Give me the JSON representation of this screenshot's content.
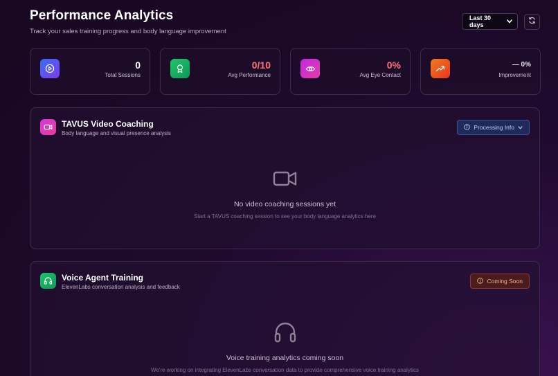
{
  "header": {
    "title": "Performance Analytics",
    "subtitle": "Track your sales training progress and body language improvement"
  },
  "controls": {
    "range_label": "Last 30 days",
    "refresh_icon": "refresh-icon"
  },
  "stats": [
    {
      "value": "0",
      "label": "Total Sessions",
      "icon": "play-circle-icon",
      "value_color": "#ffffff"
    },
    {
      "value": "0/10",
      "label": "Avg Performance",
      "icon": "award-icon",
      "value_color": "#ff6f73"
    },
    {
      "value": "0%",
      "label": "Avg Eye Contact",
      "icon": "eye-icon",
      "value_color": "#ff6f73"
    },
    {
      "value": "0%",
      "label": "Improvement",
      "icon": "trending-up-icon",
      "value_color": "#e6e0ee",
      "prefix": "—"
    }
  ],
  "video_panel": {
    "title": "TAVUS Video Coaching",
    "subtitle": "Body language and visual presence analysis",
    "badge": "Processing Info",
    "empty_title": "No video coaching sessions yet",
    "empty_sub": "Start a TAVUS coaching session to see your body language analytics here"
  },
  "voice_panel": {
    "title": "Voice Agent Training",
    "subtitle": "ElevenLabs conversation analysis and feedback",
    "badge": "Coming Soon",
    "empty_title": "Voice training analytics coming soon",
    "empty_sub": "We're working on integrating ElevenLabs conversation data to provide comprehensive voice training analytics"
  }
}
